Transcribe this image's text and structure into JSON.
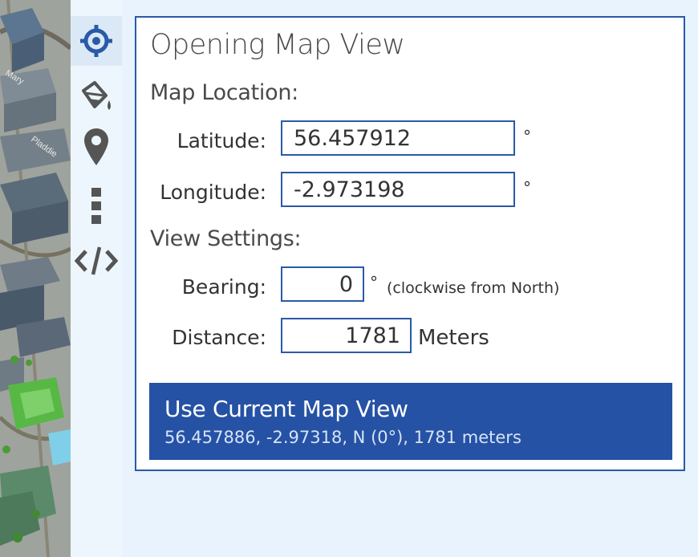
{
  "map": {
    "street_labels": [
      "Mary",
      "Pladdie"
    ]
  },
  "toolbar": {
    "items": [
      {
        "icon": "locate-crosshair-icon",
        "active": true
      },
      {
        "icon": "paint-bucket-icon",
        "active": false
      },
      {
        "icon": "map-pin-icon",
        "active": false
      },
      {
        "icon": "more-vertical-icon",
        "active": false
      },
      {
        "icon": "embed-code-icon",
        "active": false
      }
    ]
  },
  "panel": {
    "title": "Opening Map View",
    "map_location_heading": "Map Location:",
    "latitude_label": "Latitude:",
    "latitude_value": "56.457912",
    "longitude_label": "Longitude:",
    "longitude_value": "-2.973198",
    "degree_symbol": "°",
    "view_settings_heading": "View Settings:",
    "bearing_label": "Bearing:",
    "bearing_value": "0",
    "bearing_note": "(clockwise from North)",
    "distance_label": "Distance:",
    "distance_value": "1781",
    "distance_unit": "Meters",
    "use_current": {
      "title": "Use Current Map View",
      "subtitle": "56.457886, -2.97318, N (0°), 1781 meters"
    }
  },
  "colors": {
    "accent": "#2552a5",
    "panel_border": "#2a5aa7",
    "background": "#e8f3fd"
  }
}
